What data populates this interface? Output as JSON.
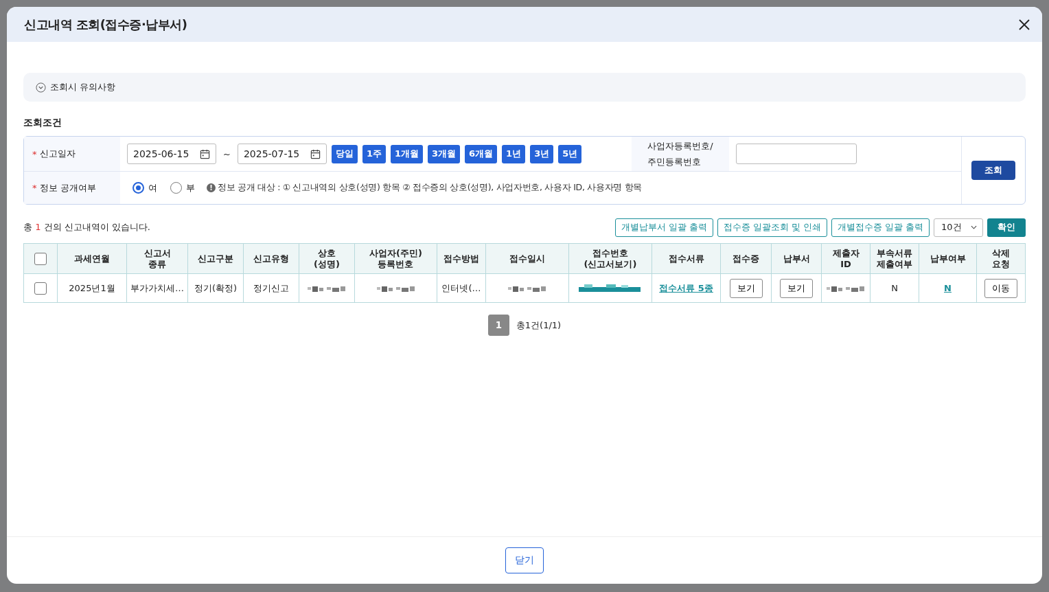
{
  "dialog": {
    "title": "신고내역 조회(접수증·납부서)"
  },
  "notice": {
    "label": "조회시 유의사항",
    "expanded": false
  },
  "conditions": {
    "title": "조회조건",
    "required_mark": "*",
    "date": {
      "label": "신고일자",
      "required": true,
      "from": "2025-06-15",
      "separator": "~",
      "to": "2025-07-15",
      "presets": [
        "당일",
        "1주",
        "1개월",
        "3개월",
        "6개월",
        "1년",
        "3년",
        "5년"
      ]
    },
    "disclosure": {
      "label": "정보 공개여부",
      "required": true,
      "options": [
        {
          "label": "여",
          "selected": true
        },
        {
          "label": "부",
          "selected": false
        }
      ],
      "info_icon": "!",
      "info": "정보 공개 대상 : ① 신고내역의 상호(성명) 항목 ② 접수증의 상호(성명), 사업자번호, 사용자 ID, 사용자명 항목"
    },
    "id_field": {
      "label_lines": [
        "사업자등록번호/",
        "주민등록번호"
      ]
    },
    "search_button": "조회"
  },
  "summary": {
    "prefix": "총",
    "count": "1",
    "suffix": "건의 신고내역이 있습니다."
  },
  "actions": [
    "개별납부서 일괄 출력",
    "접수증 일괄조회 및 인쇄",
    "개별접수증 일괄 출력"
  ],
  "page_size": "10건",
  "confirm_button": "확인",
  "table": {
    "columns": [
      {
        "kind": "checkbox",
        "checked": false
      },
      {
        "label": "과세연월"
      },
      {
        "label": "신고서\n종류"
      },
      {
        "label": "신고구분"
      },
      {
        "label": "신고유형"
      },
      {
        "label": "상호\n(성명)"
      },
      {
        "label": "사업자(주민)\n등록번호"
      },
      {
        "label": "접수방법"
      },
      {
        "label": "접수일시"
      },
      {
        "label": "접수번호\n(신고서보기)"
      },
      {
        "label": "접수서류"
      },
      {
        "label": "접수증"
      },
      {
        "label": "납부서"
      },
      {
        "label": "제출자\nID"
      },
      {
        "label": "부속서류\n제출여부"
      },
      {
        "label": "납부여부"
      },
      {
        "label": "삭제\n요청"
      }
    ],
    "rows": [
      {
        "cells": [
          {
            "kind": "checkbox",
            "checked": false
          },
          {
            "kind": "text",
            "text": "2025년1월"
          },
          {
            "kind": "text",
            "text": "부가가치세…"
          },
          {
            "kind": "text",
            "text": "정기(확정)"
          },
          {
            "kind": "text",
            "text": "정기신고"
          },
          {
            "kind": "redacted"
          },
          {
            "kind": "redacted"
          },
          {
            "kind": "text",
            "text": "인터넷(…"
          },
          {
            "kind": "redacted"
          },
          {
            "kind": "redacted_link"
          },
          {
            "kind": "link",
            "text": "접수서류 5종"
          },
          {
            "kind": "button",
            "text": "보기"
          },
          {
            "kind": "button",
            "text": "보기"
          },
          {
            "kind": "redacted"
          },
          {
            "kind": "text",
            "text": "N"
          },
          {
            "kind": "link",
            "text": "N"
          },
          {
            "kind": "button",
            "text": "이동"
          }
        ]
      }
    ]
  },
  "pagination": {
    "pages": [
      {
        "label": "1",
        "selected": true
      }
    ],
    "info": "총1건(1/1)"
  },
  "footer": {
    "close_button": "닫기"
  }
}
